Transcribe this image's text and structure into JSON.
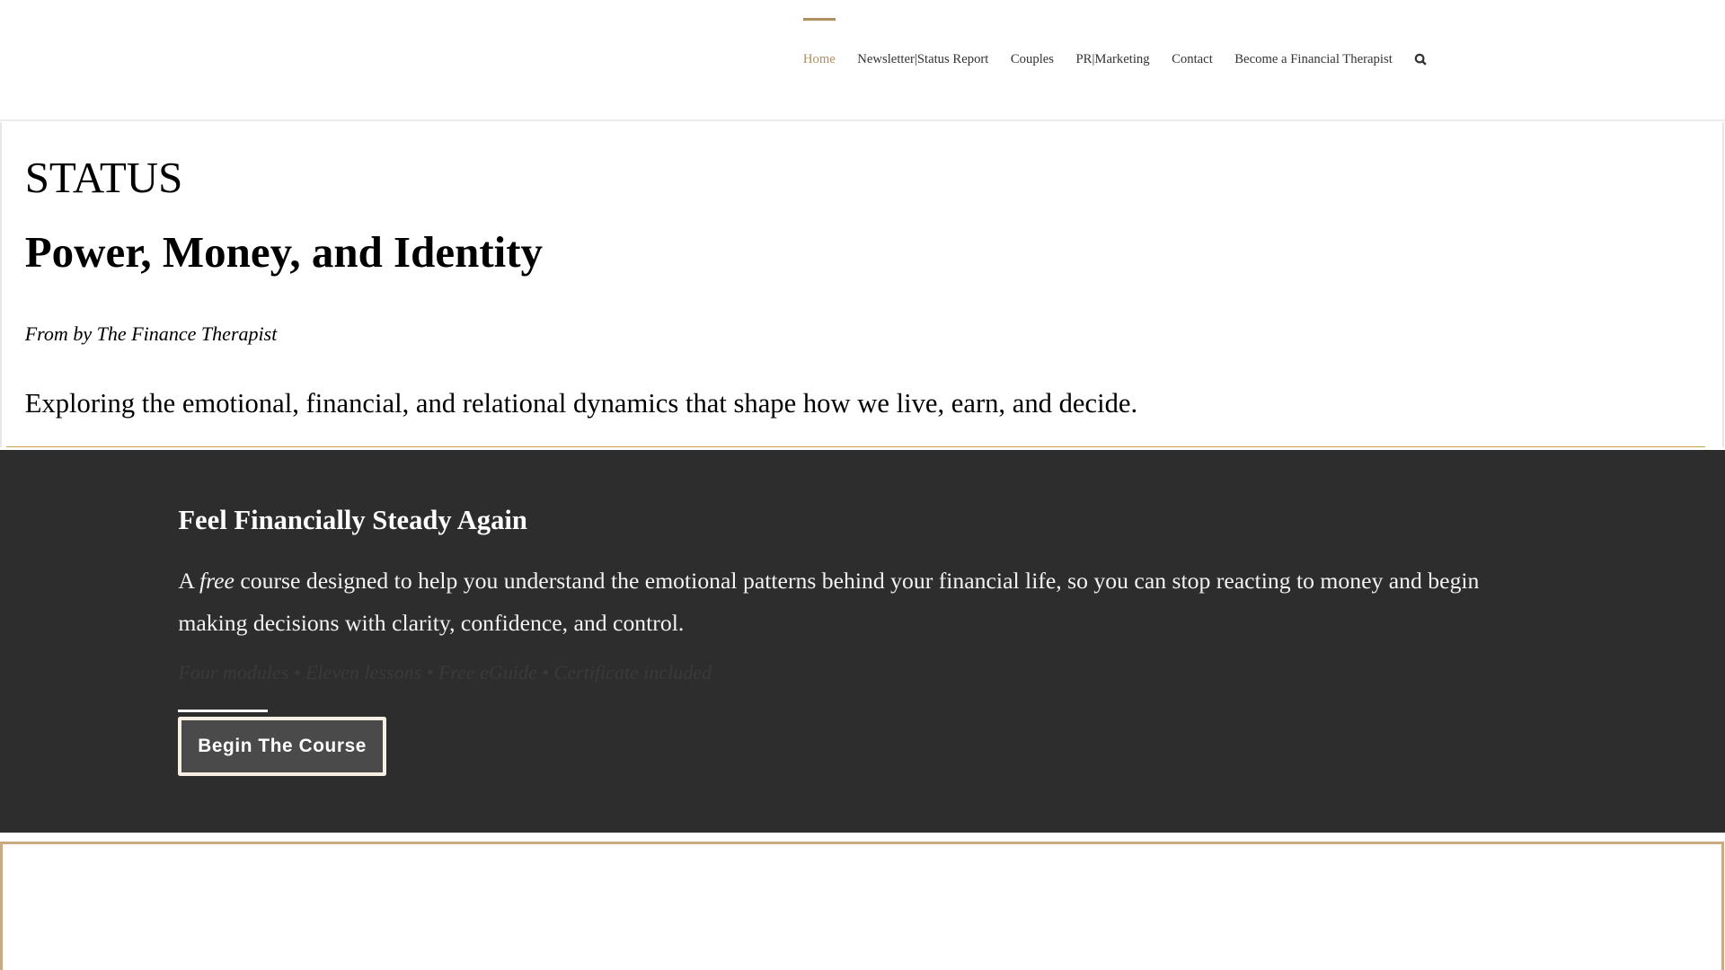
{
  "nav": {
    "items": [
      {
        "label": "Home",
        "active": true
      },
      {
        "label": "Newsletter|Status Report"
      },
      {
        "label": "Couples"
      },
      {
        "label": "PR|Marketing"
      },
      {
        "label": "Contact"
      },
      {
        "label": "Become a Financial Therapist"
      }
    ],
    "search_icon": "search-icon"
  },
  "status": {
    "title": "STATUS",
    "subtitle": "Power, Money, and Identity",
    "byline": "From by The Finance Therapist",
    "description": "Exploring the emotional, financial, and relational dynamics that shape how we live, earn, and decide."
  },
  "course": {
    "heading": "Feel Financially Steady Again",
    "body_prefix": "A ",
    "body_emphasis": "free",
    "body_rest": " course designed to help you understand the emotional patterns behind your financial life, so you can stop reacting to money and begin making decisions with clarity, confidence, and control.",
    "meta": "Four modules • Eleven lessons • Free eGuide • Certificate included",
    "button_label": "Begin The Course"
  },
  "colors": {
    "accent": "#b08d62",
    "dark_bg": "#2d2d2d",
    "gold_line": "#c9a24a"
  }
}
